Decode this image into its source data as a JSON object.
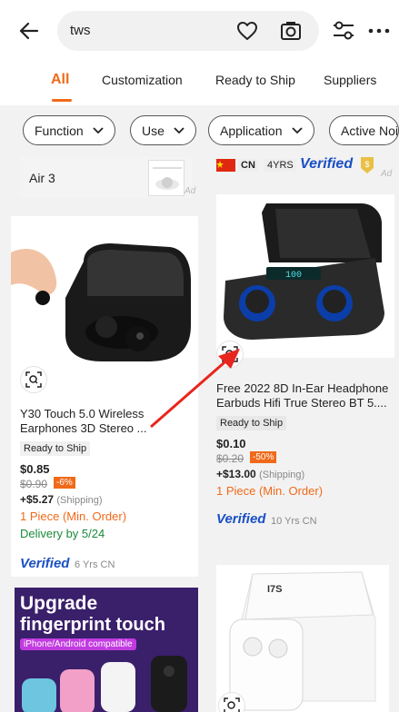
{
  "search": {
    "query": "tws"
  },
  "tabs": [
    {
      "label": "All"
    },
    {
      "label": "Customization"
    },
    {
      "label": "Ready to Ship"
    },
    {
      "label": "Suppliers"
    }
  ],
  "chips": [
    {
      "label": "Function"
    },
    {
      "label": "Use"
    },
    {
      "label": "Application"
    },
    {
      "label": "Active Noi"
    }
  ],
  "ad_small": {
    "title": "Air 3",
    "ad": "Ad"
  },
  "supplier_top": {
    "country": "CN",
    "years": "4YRS",
    "verified": "Verified",
    "ad": "Ad"
  },
  "product_left": {
    "title": "Y30 Touch 5.0 Wireless Earphones 3D Stereo ...",
    "tag": "Ready to Ship",
    "price": "$0.85",
    "old_price": "$0.90",
    "discount": "-6%",
    "shipping": "+$5.27",
    "shipping_label": "(Shipping)",
    "moq": "1 Piece (Min. Order)",
    "delivery": "Delivery by 5/24",
    "verified": "Verified",
    "years": "6 Yrs CN"
  },
  "product_right": {
    "title": "Free 2022 8D In-Ear Headphone Earbuds Hifi True Stereo BT 5....",
    "tag": "Ready to Ship",
    "price": "$0.10",
    "old_price": "$0.20",
    "discount": "-50%",
    "shipping": "+$13.00",
    "shipping_label": "(Shipping)",
    "moq": "1 Piece (Min. Order)",
    "verified": "Verified",
    "years": "10 Yrs CN"
  },
  "promo_left": {
    "line1": "Upgrade",
    "line2": "fingerprint touch",
    "badge": "iPhone/Android compatible"
  },
  "promo_right": {
    "box_label": "I7S"
  },
  "colors": {
    "accent": "#f06a1a",
    "verified": "#1a4fc4",
    "delivery": "#1a8a3a"
  }
}
